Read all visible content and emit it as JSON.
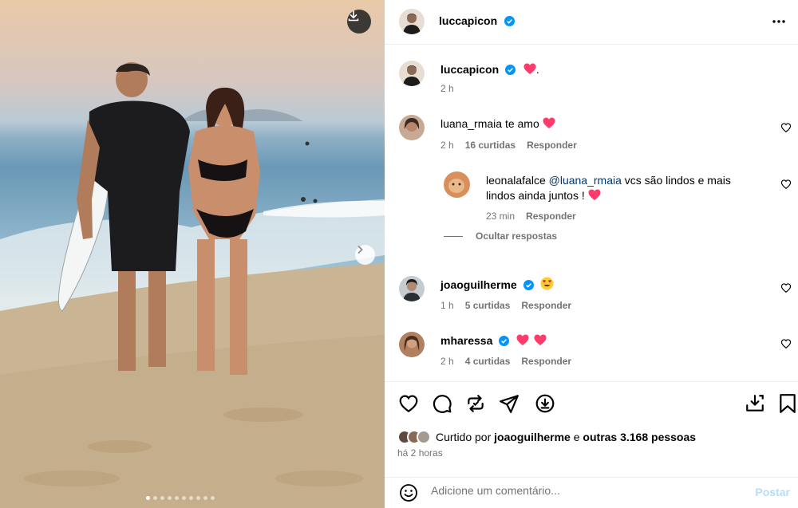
{
  "post": {
    "author": "luccapicon",
    "caption_text": ".",
    "caption_time": "2 h"
  },
  "comments": [
    {
      "username": "luana_rmaia",
      "text": "te amo",
      "time": "2 h",
      "likes": "16 curtidas",
      "reply_label": "Responder"
    },
    {
      "username": "leonalafalce",
      "mention": "@luana_rmaia",
      "text_line1": "vcs são lindos e mais",
      "text_line2": "lindos ainda juntos !",
      "time": "23 min",
      "reply_label": "Responder"
    },
    {
      "username": "joaoguilherme",
      "time": "1 h",
      "likes": "5 curtidas",
      "reply_label": "Responder"
    },
    {
      "username": "mharessa",
      "time": "2 h",
      "likes": "4 curtidas",
      "reply_label": "Responder"
    }
  ],
  "hide_replies_label": "Ocultar respostas",
  "likes_summary": {
    "prefix": "Curtido por",
    "user": "joaoguilherme",
    "connector": "e",
    "others": "outras 3.168 pessoas"
  },
  "post_time": "há 2 horas",
  "add_comment": {
    "placeholder": "Adicione um comentário...",
    "post_label": "Postar"
  },
  "carousel": {
    "total": 10,
    "active": 1
  },
  "icons": [
    "download-icon",
    "chevron-right-icon",
    "more-icon",
    "verified-icon",
    "heart-icon",
    "comment-icon",
    "repost-icon",
    "share-icon",
    "download-icon",
    "save-icon",
    "emoji-icon"
  ],
  "colors": {
    "verified": "#0095f6",
    "emoji_heart": "#ff3b6b",
    "meta": "#737373",
    "post_disabled": "#b2dffc",
    "mention": "#00376b"
  }
}
